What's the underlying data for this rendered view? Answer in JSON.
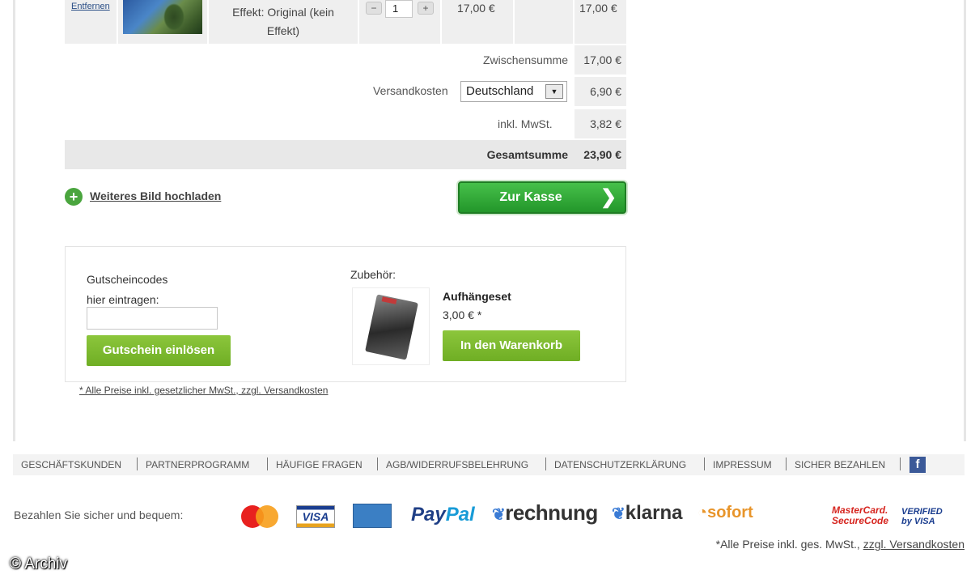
{
  "cart": {
    "remove_label": "Entfernen",
    "effect_text": "Effekt: Original (kein Effekt)",
    "quantity": "1",
    "unit_price": "17,00 €",
    "line_total": "17,00 €"
  },
  "summary": {
    "subtotal_label": "Zwischensumme",
    "subtotal_value": "17,00 €",
    "shipping_label": "Versandkosten",
    "shipping_country": "Deutschland",
    "shipping_value": "6,90 €",
    "tax_label": "inkl. MwSt.",
    "tax_value": "3,82 €",
    "total_label": "Gesamtsumme",
    "total_value": "23,90 €"
  },
  "actions": {
    "upload_label": "Weiteres Bild hochladen",
    "checkout_label": "Zur Kasse"
  },
  "voucher": {
    "title_line1": "Gutscheincodes",
    "title_line2": "hier eintragen:",
    "input_value": "",
    "button_label": "Gutschein einlösen"
  },
  "accessories": {
    "title": "Zubehör:",
    "name": "Aufhängeset",
    "price": "3,00 € *",
    "button_label": "In den Warenkorb"
  },
  "price_note": "* Alle Preise inkl. gesetzlicher MwSt., zzgl. Versandkosten",
  "footer_nav": [
    "GESCHÄFTSKUNDEN",
    "PARTNERPROGRAMM",
    "HÄUFIGE FRAGEN",
    "AGB/WIDERRUFSBELEHRUNG",
    "DATENSCHUTZERKLÄRUNG",
    "IMPRESSUM",
    "SICHER BEZAHLEN"
  ],
  "payment": {
    "text": "Bezahlen Sie sicher und bequem:",
    "visa": "VISA",
    "paypal_1": "Pay",
    "paypal_2": "Pal",
    "rechnung": "rechnung",
    "klarna": "klarna",
    "sofort": "sofort",
    "mastercard_securecode_1": "MasterCard.",
    "mastercard_securecode_2": "SecureCode",
    "verified_1": "VERIFIED",
    "verified_2": "by VISA"
  },
  "bottom_note": {
    "prefix": "*Alle Preise inkl. ges. MwSt., ",
    "link": "zzgl. Versandkosten"
  },
  "watermark": "© Archiv",
  "colors": {
    "checkout_green": "#23962a",
    "action_green": "#7ab52e",
    "facebook_blue": "#3b5998"
  }
}
